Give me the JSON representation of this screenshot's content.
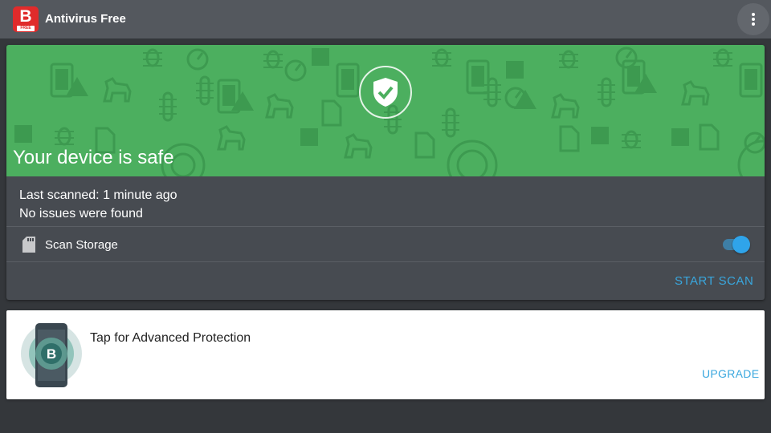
{
  "app_bar": {
    "logo_letter": "B",
    "logo_badge": "FREE",
    "title": "Antivirus Free",
    "overflow_icon": "more-vert-icon"
  },
  "status": {
    "headline": "Your device is safe",
    "shield_icon": "shield-check-icon",
    "last_scanned": "Last scanned: 1 minute ago",
    "issues": "No issues were found",
    "storage_icon": "sd-card-icon",
    "storage_label": "Scan Storage",
    "storage_toggle_on": true,
    "start_scan_label": "START SCAN"
  },
  "promo": {
    "title": "Tap for Advanced Protection",
    "upgrade_label": "UPGRADE",
    "illustration_letter": "B"
  },
  "colors": {
    "app_bar": "#54585e",
    "background": "#34373b",
    "card": "#474b51",
    "safe_green": "#4caf5f",
    "accent_blue": "#39a7de",
    "toggle_thumb": "#2fa4ea",
    "logo_red": "#e02b2b"
  }
}
